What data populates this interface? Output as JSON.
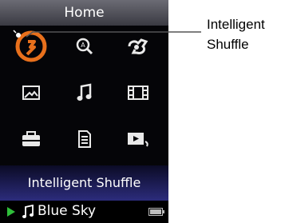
{
  "header": {
    "title": "Home"
  },
  "menu": {
    "icons": [
      {
        "name": "intelligent-shuffle-icon",
        "selected": true
      },
      {
        "name": "search-icon",
        "selected": false
      },
      {
        "name": "playlist-icon",
        "selected": false
      },
      {
        "name": "photo-icon",
        "selected": false
      },
      {
        "name": "music-icon",
        "selected": false
      },
      {
        "name": "video-icon",
        "selected": false
      },
      {
        "name": "settings-icon",
        "selected": false
      },
      {
        "name": "podcast-icon",
        "selected": false
      },
      {
        "name": "now-playing-icon",
        "selected": false
      }
    ],
    "selected_label": "Intelligent Shuffle"
  },
  "status": {
    "song": "Blue Sky",
    "play_icon": "play-icon",
    "note_icon": "note-icon",
    "battery_icon": "battery-icon"
  },
  "callout": {
    "line1": "Intelligent",
    "line2": "Shuffle"
  },
  "colors": {
    "accent": "#e8701c",
    "status_play": "#2fbf3a",
    "icon": "#e9e9e9",
    "header": "#55555d",
    "bottom_bar": "#23236a"
  }
}
